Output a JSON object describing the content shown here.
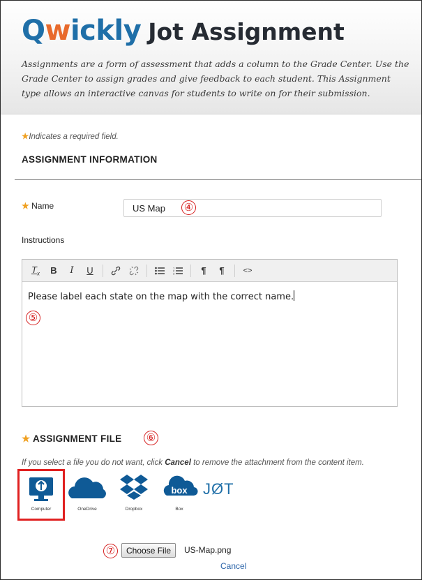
{
  "header": {
    "brand_q": "Q",
    "brand_w": "w",
    "brand_rest": "ickly",
    "title": "Jot Assignment",
    "description": "Assignments are a form of assessment that adds a column to the Grade Center.  Use the Grade Center to assign grades and give feedback to each student. This Assignment type allows an interactive canvas for students to write on for their submission."
  },
  "form": {
    "required_note": "Indicates a required field.",
    "required_star": "★",
    "section_title": "ASSIGNMENT INFORMATION",
    "name_label": "Name",
    "name_value": "US Map",
    "instructions_label": "Instructions",
    "instructions_text": "Please label each state on the map with the correct name.",
    "toolbar": [
      "clear-format",
      "bold",
      "italic",
      "underline",
      "link",
      "unlink",
      "bullet-list",
      "numbered-list",
      "paragraph-ltr",
      "paragraph-rtl",
      "source-code"
    ],
    "toolbar_glyphs": {
      "clear-format": "I̲ₓ",
      "bold": "B",
      "italic": "I",
      "underline": "U",
      "link": "⛓",
      "unlink": "✂",
      "bullet-list": "☰",
      "numbered-list": "≡",
      "paragraph-ltr": "¶",
      "paragraph-rtl": "¶",
      "source-code": "<>"
    }
  },
  "file_section": {
    "title": "ASSIGNMENT FILE",
    "help_prefix": "If you select a file you do not want, click ",
    "help_cancel": "Cancel",
    "help_suffix": " to remove the attachment from the content item.",
    "sources": [
      {
        "id": "computer",
        "label": "Computer",
        "selected": true
      },
      {
        "id": "onedrive",
        "label": "OneDrive",
        "selected": false
      },
      {
        "id": "dropbox",
        "label": "Dropbox",
        "selected": false
      },
      {
        "id": "box",
        "label": "Box",
        "selected": false
      },
      {
        "id": "jot",
        "label": "JØT",
        "selected": false
      }
    ],
    "choose_file_label": "Choose File",
    "file_name": "US-Map.png",
    "cancel_label": "Cancel"
  },
  "callouts": {
    "name": "④",
    "instructions": "⑤",
    "file_title": "⑥",
    "choose_file": "⑦"
  },
  "colors": {
    "brand_blue": "#1f6fa8",
    "brand_orange": "#e86a2c",
    "required_star": "#f0a020",
    "callout_red": "#d62020",
    "link_blue": "#2a63a8"
  }
}
